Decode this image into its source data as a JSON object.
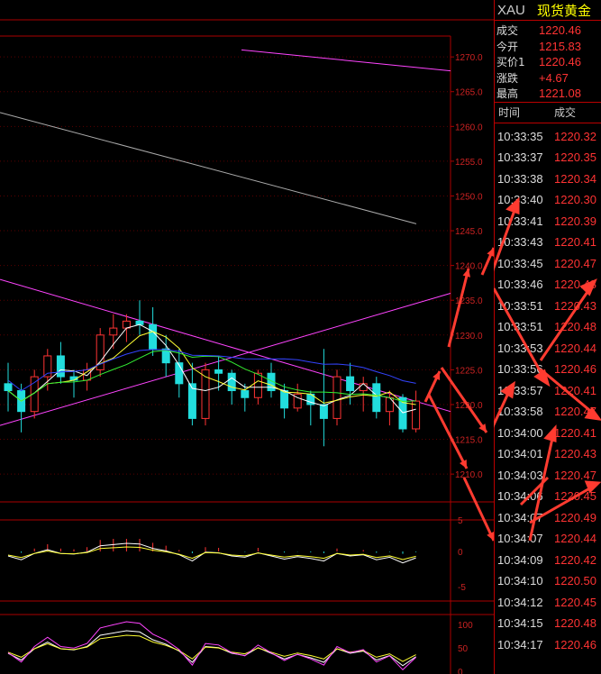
{
  "header": {
    "symbol": "XAU",
    "name": "现货黄金"
  },
  "quote": [
    {
      "label": "成交",
      "value": "1220.46"
    },
    {
      "label": "今开",
      "value": "1215.83"
    },
    {
      "label": "买价1",
      "value": "1220.46"
    },
    {
      "label": "涨跌",
      "value": "+4.67"
    },
    {
      "label": "最高",
      "value": "1221.08"
    }
  ],
  "tick_table": {
    "headers": [
      "时间",
      "成交"
    ],
    "rows": [
      {
        "time": "10:33:35",
        "price": "1220.32"
      },
      {
        "time": "10:33:37",
        "price": "1220.35"
      },
      {
        "time": "10:33:38",
        "price": "1220.34"
      },
      {
        "time": "10:33:40",
        "price": "1220.30"
      },
      {
        "time": "10:33:41",
        "price": "1220.39"
      },
      {
        "time": "10:33:43",
        "price": "1220.41"
      },
      {
        "time": "10:33:45",
        "price": "1220.47"
      },
      {
        "time": "10:33:46",
        "price": "1220.48"
      },
      {
        "time": "10:33:51",
        "price": "1220.43"
      },
      {
        "time": "10:33:51",
        "price": "1220.48"
      },
      {
        "time": "10:33:53",
        "price": "1220.44"
      },
      {
        "time": "10:33:56",
        "price": "1220.46"
      },
      {
        "time": "10:33:57",
        "price": "1220.41"
      },
      {
        "time": "10:33:58",
        "price": "1220.47"
      },
      {
        "time": "10:34:00",
        "price": "1220.41"
      },
      {
        "time": "10:34:01",
        "price": "1220.43"
      },
      {
        "time": "10:34:03",
        "price": "1220.47"
      },
      {
        "time": "10:34:06",
        "price": "1220.45"
      },
      {
        "time": "10:34:07",
        "price": "1220.49"
      },
      {
        "time": "10:34:07",
        "price": "1220.44"
      },
      {
        "time": "10:34:09",
        "price": "1220.42"
      },
      {
        "time": "10:34:10",
        "price": "1220.50"
      },
      {
        "time": "10:34:12",
        "price": "1220.45"
      },
      {
        "time": "10:34:15",
        "price": "1220.48"
      },
      {
        "time": "10:34:17",
        "price": "1220.46"
      }
    ]
  },
  "main_chart": {
    "y_axis_ticks": [
      "1270.0",
      "1265.0",
      "1260.0",
      "1255.0",
      "1250.0",
      "1245.0",
      "1240.0",
      "1235.0",
      "1230.0",
      "1225.0",
      "1220.0",
      "1215.0",
      "1210.0"
    ],
    "y_range": [
      1206,
      1273
    ],
    "candles": [
      [
        1223.0,
        1226.0,
        1219.0,
        1222.0
      ],
      [
        1222.0,
        1223.0,
        1216.0,
        1219.0
      ],
      [
        1219.0,
        1225.0,
        1218.0,
        1224.0
      ],
      [
        1224.0,
        1228.0,
        1222.0,
        1227.0
      ],
      [
        1227.0,
        1229.0,
        1223.0,
        1224.0
      ],
      [
        1224.0,
        1225.0,
        1221.0,
        1223.5
      ],
      [
        1223.5,
        1226.0,
        1222.0,
        1225.0
      ],
      [
        1225.0,
        1231.0,
        1224.0,
        1230.0
      ],
      [
        1230.0,
        1233.0,
        1228.0,
        1231.0
      ],
      [
        1231.0,
        1233.0,
        1229.0,
        1232.0
      ],
      [
        1232.0,
        1235.0,
        1230.0,
        1231.5
      ],
      [
        1231.5,
        1234.0,
        1227.0,
        1228.0
      ],
      [
        1228.0,
        1230.0,
        1224.0,
        1226.0
      ],
      [
        1226.0,
        1228.0,
        1221.0,
        1223.0
      ],
      [
        1223.0,
        1226.0,
        1217.0,
        1218.0
      ],
      [
        1218.0,
        1226.0,
        1217.0,
        1225.0
      ],
      [
        1225.0,
        1227.0,
        1222.0,
        1224.5
      ],
      [
        1224.5,
        1225.0,
        1220.0,
        1222.0
      ],
      [
        1222.0,
        1223.0,
        1219.0,
        1221.0
      ],
      [
        1221.0,
        1225.0,
        1220.0,
        1224.5
      ],
      [
        1224.5,
        1226.0,
        1221.0,
        1222.0
      ],
      [
        1222.0,
        1223.0,
        1218.0,
        1219.5
      ],
      [
        1219.5,
        1223.0,
        1219.0,
        1221.5
      ],
      [
        1221.5,
        1222.0,
        1217.0,
        1220.0
      ],
      [
        1220.0,
        1228.0,
        1214.0,
        1218.0
      ],
      [
        1218.0,
        1225.0,
        1217.0,
        1224.0
      ],
      [
        1224.0,
        1226.0,
        1220.0,
        1222.0
      ],
      [
        1222.0,
        1224.0,
        1219.0,
        1223.0
      ],
      [
        1223.0,
        1224.0,
        1218.0,
        1219.0
      ],
      [
        1219.0,
        1222.0,
        1217.0,
        1221.0
      ],
      [
        1221.0,
        1221.5,
        1216.0,
        1216.5
      ],
      [
        1216.5,
        1222.0,
        1216.0,
        1220.5
      ]
    ],
    "lines": [
      {
        "name": "upper-trendline",
        "color": "#ff44ff",
        "points": [
          [
            268,
            1271
          ],
          [
            500,
            1268
          ]
        ]
      },
      {
        "name": "gray-trendline",
        "color": "#aaaaaa",
        "points": [
          [
            0,
            1262
          ],
          [
            462,
            1246
          ]
        ]
      },
      {
        "name": "rising-channel-line",
        "color": "#ff44ff",
        "points": [
          [
            0,
            1217
          ],
          [
            500,
            1236
          ]
        ]
      },
      {
        "name": "falling-channel-line",
        "color": "#ff44ff",
        "points": [
          [
            0,
            1238
          ],
          [
            500,
            1219
          ]
        ]
      }
    ]
  },
  "macd": {
    "y_axis_ticks": [
      "5",
      "0",
      "-5"
    ]
  },
  "kdj": {
    "y_axis_ticks": [
      "100",
      "50",
      "0"
    ]
  },
  "colors": {
    "up": "#ff3333",
    "down": "#22dddd",
    "grid": "#aa0000",
    "arrow": "#ff3b30",
    "ma_white": "#ffffff",
    "ma_yellow": "#ffff33",
    "ma_green": "#33ee33",
    "ma_blue": "#3344ff"
  }
}
